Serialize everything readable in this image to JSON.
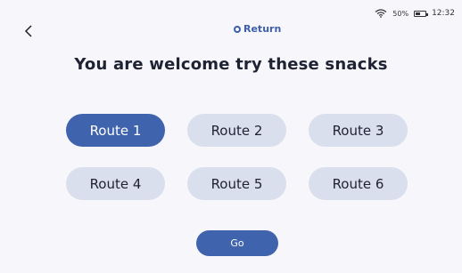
{
  "status": {
    "battery": "50%",
    "time": "12:32"
  },
  "nav": {
    "return_label": "Return"
  },
  "title": "You are welcome try these snacks",
  "routes": [
    {
      "label": "Route 1",
      "selected": true
    },
    {
      "label": "Route 2",
      "selected": false
    },
    {
      "label": "Route 3",
      "selected": false
    },
    {
      "label": "Route 4",
      "selected": false
    },
    {
      "label": "Route 5",
      "selected": false
    },
    {
      "label": "Route 6",
      "selected": false
    }
  ],
  "actions": {
    "go_label": "Go"
  },
  "colors": {
    "accent": "#3f63ad",
    "button_bg": "#d9dfec",
    "background": "#f7f7fb"
  },
  "icons": {
    "back": "chevron-left-icon",
    "return": "return-icon",
    "wifi": "wifi-icon",
    "battery": "battery-icon"
  }
}
